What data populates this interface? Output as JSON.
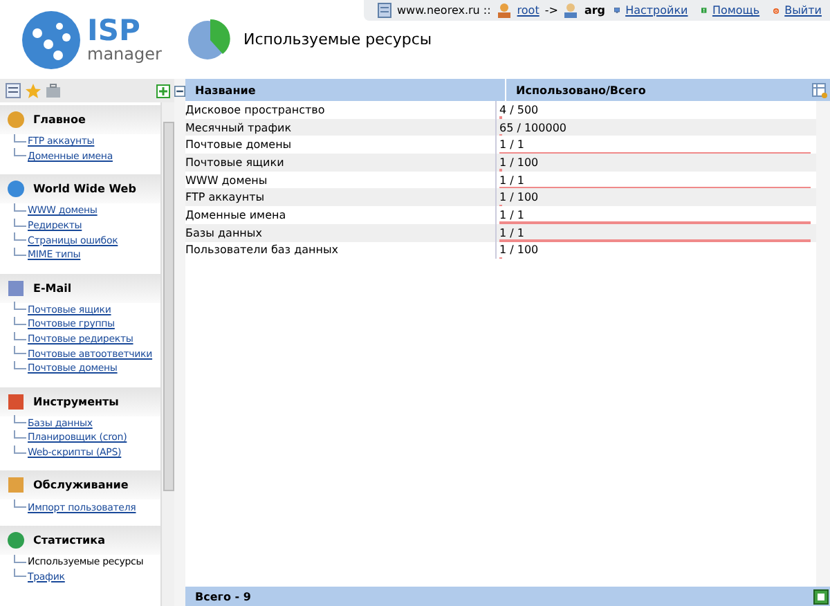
{
  "logo": {
    "brand": "ISP",
    "sub": "manager"
  },
  "page_title": "Используемые ресурсы",
  "session": {
    "host": "www.neorex.ru ::",
    "user": "root",
    "arrow": "->",
    "target": "arg"
  },
  "top_links": [
    "Настройки",
    "Помощь",
    "Выйти"
  ],
  "sidebar": {
    "sections": [
      {
        "title": "Главное",
        "items": [
          {
            "label": "FTP аккаунты",
            "selected": false
          },
          {
            "label": "Доменные имена",
            "selected": false
          }
        ]
      },
      {
        "title": "World Wide Web",
        "items": [
          {
            "label": "WWW домены",
            "selected": false
          },
          {
            "label": "Редиректы",
            "selected": false
          },
          {
            "label": "Страницы ошибок",
            "selected": false
          },
          {
            "label": "MIME типы",
            "selected": false
          }
        ]
      },
      {
        "title": "E-Mail",
        "items": [
          {
            "label": "Почтовые ящики",
            "selected": false
          },
          {
            "label": "Почтовые группы",
            "selected": false
          },
          {
            "label": "Почтовые редиректы",
            "selected": false
          },
          {
            "label": "Почтовые автоответчики",
            "selected": false
          },
          {
            "label": "Почтовые домены",
            "selected": false
          }
        ]
      },
      {
        "title": "Инструменты",
        "items": [
          {
            "label": "Базы данных",
            "selected": false
          },
          {
            "label": "Планировщик (cron)",
            "selected": false
          },
          {
            "label": "Web-скрипты (APS)",
            "selected": false
          }
        ]
      },
      {
        "title": "Обслуживание",
        "items": [
          {
            "label": "Импорт пользователя",
            "selected": false
          }
        ]
      },
      {
        "title": "Статистика",
        "items": [
          {
            "label": "Используемые ресурсы",
            "selected": true
          },
          {
            "label": "Трафик",
            "selected": false
          }
        ]
      }
    ]
  },
  "table": {
    "columns": [
      "Название",
      "Использовано/Всего"
    ],
    "rows": [
      {
        "name": "Дисковое пространство",
        "usage": "4 / 500",
        "level": 0.008
      },
      {
        "name": "Месячный трафик",
        "usage": "65 / 100000",
        "level": 0.001
      },
      {
        "name": "Почтовые домены",
        "usage": "1 / 1",
        "level": 1
      },
      {
        "name": "Почтовые ящики",
        "usage": "1 / 100",
        "level": 0.01
      },
      {
        "name": "WWW домены",
        "usage": "1 / 1",
        "level": 1
      },
      {
        "name": "FTP аккаунты",
        "usage": "1 / 100",
        "level": 0.01
      },
      {
        "name": "Доменные имена",
        "usage": "1 / 1",
        "level": 1
      },
      {
        "name": "Базы данных",
        "usage": "1 / 1",
        "level": 1
      },
      {
        "name": "Пользователи баз данных",
        "usage": "1 / 100",
        "level": 0.01
      }
    ],
    "footer": "Всего - 9"
  }
}
